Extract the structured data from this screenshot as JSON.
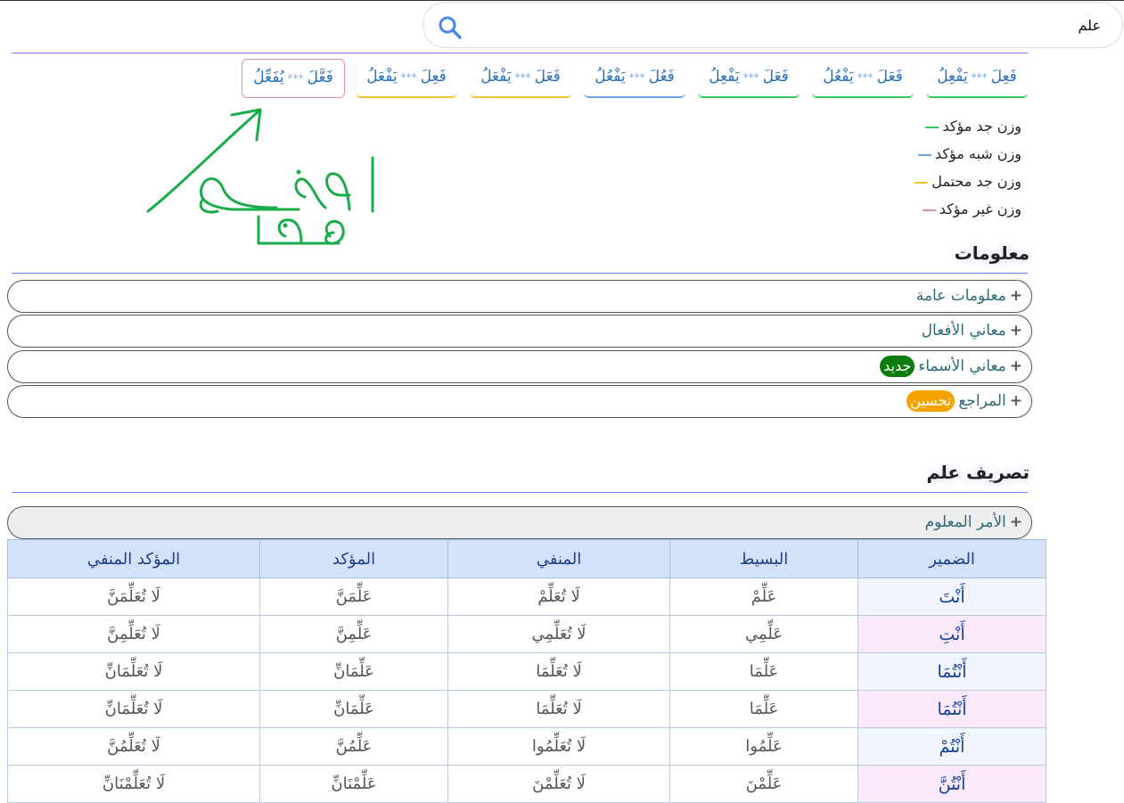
{
  "search": {
    "value": "علم"
  },
  "patterns": [
    {
      "label": "فَعِلَ *** يَفْعِلُ",
      "color": "#34c759"
    },
    {
      "label": "فَعَلَ *** يَفْعُلُ",
      "color": "#34c759"
    },
    {
      "label": "فَعَلَ *** يَفْعِلُ",
      "color": "#34c759"
    },
    {
      "label": "فَعُلَ *** يَفْعُلُ",
      "color": "#6aa8e8"
    },
    {
      "label": "فَعَلَ *** يَفْعَلُ",
      "color": "#f5c12e"
    },
    {
      "label": "فَعِلَ *** يَفْعَلُ",
      "color": "#f5c12e"
    },
    {
      "label": "فَعَّلَ *** يُفَعِّلُ",
      "color": "#e58bb3"
    }
  ],
  "legend": [
    {
      "label": "وزن جد مؤكد",
      "color": "#34c759"
    },
    {
      "label": "وزن شبه مؤكد",
      "color": "#6aa8e8"
    },
    {
      "label": "وزن جد محتمل",
      "color": "#f5c12e"
    },
    {
      "label": "وزن غير مؤكد",
      "color": "#e58bb3"
    }
  ],
  "info": {
    "heading": "معلومات",
    "items": [
      {
        "label": "معلومات عامة"
      },
      {
        "label": "معاني الأفعال"
      },
      {
        "label": "معاني الأسماء",
        "badge": "جديد",
        "badge_color": "#0a7d0a"
      },
      {
        "label": "المراجع",
        "badge": "تحسين",
        "badge_color": "#f5a300"
      }
    ]
  },
  "conjugation": {
    "heading": "تصريف علم",
    "section": "الأمر المعلوم",
    "columns": [
      "الضمير",
      "البسيط",
      "المنفي",
      "المؤكد",
      "المؤكد المنفي"
    ],
    "rows": [
      {
        "pronoun": "أَنْتَ",
        "g": "m",
        "simple": "عَلِّمْ",
        "neg": "لَا تُعَلِّمْ",
        "emph": "عَلِّمَنَّ",
        "neg_emph": "لَا تُعَلِّمَنَّ"
      },
      {
        "pronoun": "أَنْتِ",
        "g": "f",
        "simple": "عَلِّمِي",
        "neg": "لَا تُعَلِّمِي",
        "emph": "عَلِّمِنَّ",
        "neg_emph": "لَا تُعَلِّمِنَّ"
      },
      {
        "pronoun": "أَنْتُمَا",
        "g": "m",
        "simple": "عَلِّمَا",
        "neg": "لَا تُعَلِّمَا",
        "emph": "عَلِّمَانِّ",
        "neg_emph": "لَا تُعَلِّمَانِّ"
      },
      {
        "pronoun": "أَنْتُمَا",
        "g": "f",
        "simple": "عَلِّمَا",
        "neg": "لَا تُعَلِّمَا",
        "emph": "عَلِّمَانِّ",
        "neg_emph": "لَا تُعَلِّمَانِّ"
      },
      {
        "pronoun": "أَنْتُمْ",
        "g": "m",
        "simple": "عَلِّمُوا",
        "neg": "لَا تُعَلِّمُوا",
        "emph": "عَلِّمُنَّ",
        "neg_emph": "لَا تُعَلِّمُنَّ"
      },
      {
        "pronoun": "أَنْتُنَّ",
        "g": "f",
        "simple": "عَلِّمْنَ",
        "neg": "لَا تُعَلِّمْنَ",
        "emph": "عَلِّمْنَانِّ",
        "neg_emph": "لَا تُعَلِّمْنَانِّ"
      }
    ]
  },
  "annotation": {
    "text": "اضغط هنا",
    "color": "#1aab4a"
  }
}
